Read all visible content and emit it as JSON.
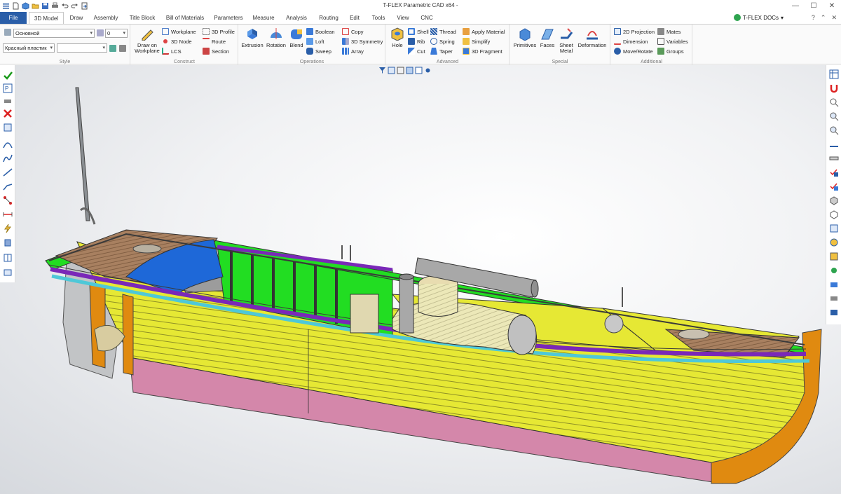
{
  "app": {
    "title": "T-FLEX Parametric CAD x64 -"
  },
  "docs_button": "T-FLEX DOCs",
  "tabs": [
    "File",
    "3D Model",
    "Draw",
    "Assembly",
    "Title Block",
    "Bill of Materials",
    "Parameters",
    "Measure",
    "Analysis",
    "Routing",
    "Edit",
    "Tools",
    "View",
    "CNC"
  ],
  "style": {
    "layer": "Основной",
    "level": "0",
    "material": "Красный пластик",
    "label": "Style"
  },
  "construct": {
    "draw_on_workplane": "Draw on Workplane",
    "workplane": "Workplane",
    "node3d": "3D Node",
    "lcs": "LCS",
    "profile3d": "3D Profile",
    "route": "Route",
    "section": "Section",
    "label": "Construct"
  },
  "operations": {
    "extrusion": "Extrusion",
    "rotation": "Rotation",
    "blend": "Blend",
    "boolean": "Boolean",
    "loft": "Loft",
    "sweep": "Sweep",
    "copy": "Copy",
    "symmetry3d": "3D Symmetry",
    "array": "Array",
    "label": "Operations"
  },
  "advanced": {
    "hole": "Hole",
    "shell": "Shell",
    "rib": "Rib",
    "cut": "Cut",
    "thread": "Thread",
    "spring": "Spring",
    "taper": "Taper",
    "apply_material": "Apply Material",
    "simplify": "Simplify",
    "fragment3d": "3D Fragment",
    "label": "Advanced"
  },
  "special": {
    "primitives": "Primitives",
    "faces": "Faces",
    "sheet_metal": "Sheet Metal",
    "deformation": "Deformation",
    "label": "Special"
  },
  "additional": {
    "projection2d": "2D Projection",
    "dimension": "Dimension",
    "move_rotate": "Move/Rotate",
    "mates": "Mates",
    "variables": "Variables",
    "groups": "Groups",
    "label": "Additional"
  },
  "colors": {
    "accent": "#2a5ea8",
    "hull_yellow": "#e6e834",
    "deck_green": "#22dd22",
    "keel_pink": "#d487aa",
    "trim_purple": "#7a28b8",
    "trim_cyan": "#4ec8d8",
    "stem_orange": "#e08a10",
    "deck_wood": "#a88060",
    "seat_blue": "#1e68d8"
  }
}
